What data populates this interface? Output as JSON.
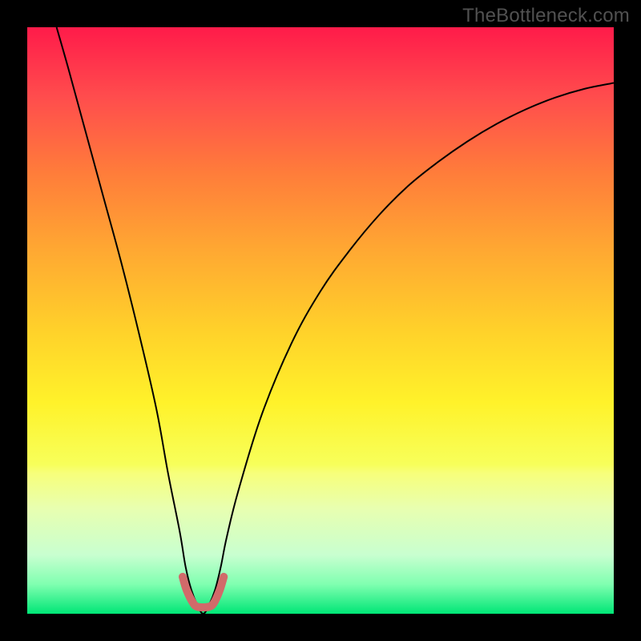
{
  "brand": {
    "text": "TheBottleneck.com"
  },
  "chart_data": {
    "type": "line",
    "title": "",
    "xlabel": "",
    "ylabel": "",
    "xlim": [
      0,
      100
    ],
    "ylim": [
      0,
      100
    ],
    "legend": false,
    "grid": false,
    "background_gradient": {
      "top": "#ff1b4a",
      "mid_upper": "#ffa832",
      "mid": "#fff22a",
      "mid_lower": "#d0ff80",
      "bottom": "#00e676"
    },
    "series": [
      {
        "name": "bottleneck-curve",
        "stroke": "#000000",
        "stroke_width": 2,
        "x": [
          5,
          7,
          10,
          13,
          16,
          19,
          22,
          24,
          26,
          27,
          28,
          29,
          30,
          31,
          32,
          33,
          34,
          36,
          40,
          45,
          50,
          55,
          60,
          65,
          70,
          75,
          80,
          85,
          90,
          95,
          100
        ],
        "y": [
          100,
          93,
          82,
          71,
          60,
          48,
          35,
          24,
          14,
          8,
          4,
          1.5,
          0,
          1.5,
          4,
          8,
          13,
          21,
          34,
          46,
          55,
          62,
          68,
          73,
          77,
          80.5,
          83.5,
          86,
          88,
          89.5,
          90.5
        ]
      },
      {
        "name": "optimal-region",
        "stroke": "#d16a6a",
        "stroke_width": 10,
        "linecap": "round",
        "x": [
          26.5,
          27.2,
          28.3,
          29,
          30,
          31,
          31.8,
          32.8,
          33.5
        ],
        "y": [
          6.3,
          4,
          1.8,
          1.2,
          1.1,
          1.2,
          1.8,
          4,
          6.3
        ]
      }
    ]
  }
}
